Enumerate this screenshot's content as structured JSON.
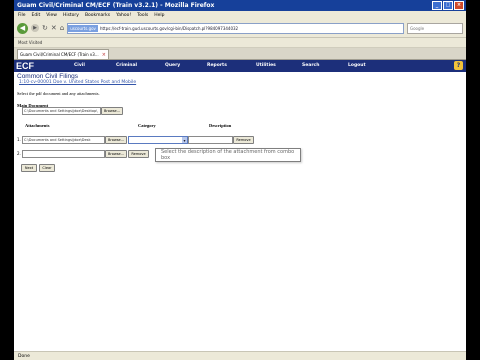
{
  "window": {
    "title": "Guam Civil/Criminal CM/ECF (Train v3.2.1) - Mozilla Firefox"
  },
  "menu": [
    "File",
    "Edit",
    "View",
    "History",
    "Bookmarks",
    "Yahoo!",
    "Tools",
    "Help"
  ],
  "toolbar": {
    "url_tag": "uscourts.gov",
    "url": "https://ecf-train.gud.uscourts.gov/cgi-bin/Dispatch.pl?984097344032",
    "search_placeholder": "Google"
  },
  "bookmarks": {
    "item": "Most Visited"
  },
  "tab": {
    "label": "Guam Civil/Criminal CM/ECF (Train v3..."
  },
  "cmecf_nav": {
    "logo": "ECF",
    "items": [
      "Civil",
      "Criminal",
      "Query",
      "Reports",
      "Utilities",
      "Search",
      "Logout"
    ]
  },
  "page": {
    "heading": "Common Civil Filings",
    "case": "1:10-cv-00001 Doe v. United States Post and Mobile",
    "instruction": "Select the pdf document and any attachments.",
    "main_document_label": "Main Document",
    "main_document_value": "C:\\Documents and Settings\\jdoe\\Desktop\\",
    "browse": "Browse...",
    "attachments_label": "Attachments",
    "category_label": "Category",
    "description_label": "Description",
    "attachments": [
      {
        "num": "1.",
        "value": "C:\\Documents and Settings\\jdoe\\Desk",
        "remove": "Remove"
      },
      {
        "num": "2.",
        "value": "",
        "remove": "Remove"
      }
    ],
    "tooltip": "Select the description of the attachment from combo box",
    "next": "Next",
    "clear": "Clear"
  },
  "status": {
    "text": "Done"
  }
}
